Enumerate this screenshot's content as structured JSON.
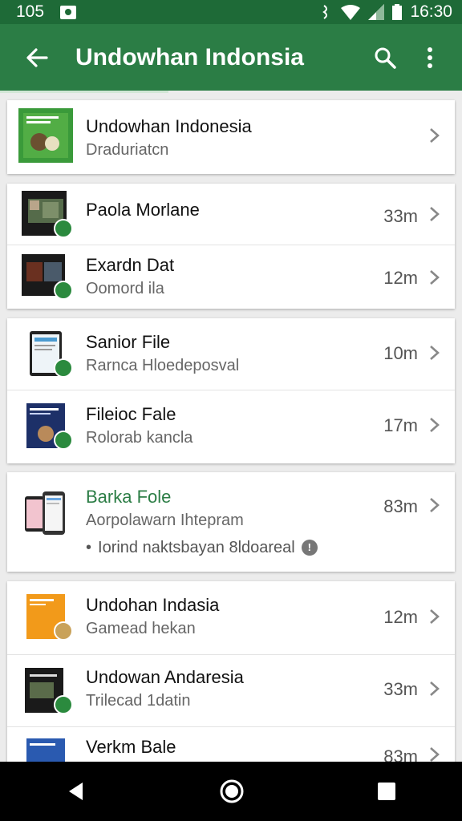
{
  "status_bar": {
    "time_left": "105",
    "time_right": "16:30"
  },
  "app_bar": {
    "title": "Undowhan Indonsia",
    "back_icon": "arrow-back-icon",
    "search_icon": "search-icon",
    "menu_icon": "more-vert-icon"
  },
  "colors": {
    "primary": "#2b7d45",
    "status": "#1e6a37",
    "accent_green": "#2b8a3e"
  },
  "items": [
    {
      "title": "Undowhan Indonesia",
      "sub": "Draduriatcn",
      "meta": ""
    },
    {
      "title": "Paola Morlane",
      "sub": "",
      "meta": "33m"
    },
    {
      "title": "Exardn Dat",
      "sub": "Oomord ila",
      "meta": "12m"
    },
    {
      "title": "Sanior File",
      "sub": "Rarnca Hloedeposval",
      "meta": "10m"
    },
    {
      "title": "Fileioc Fale",
      "sub": "Rolorab kancla",
      "meta": "17m"
    },
    {
      "title": "Barka Fole",
      "sub": "Aorpolawarn Ihtepram",
      "extra": "Iorind naktsbayan 8ldoareal",
      "meta": "83m"
    },
    {
      "title": "Undohan Indasia",
      "sub": "Gamead hekan",
      "meta": "12m"
    },
    {
      "title": "Undowan Andaresia",
      "sub": "Trilecad 1datin",
      "meta": "33m"
    },
    {
      "title": "Verkm Bale",
      "sub": "",
      "meta": "83m"
    }
  ],
  "nav_bar": {
    "back": "nav-back-icon",
    "home": "nav-home-icon",
    "recents": "nav-recents-icon"
  }
}
